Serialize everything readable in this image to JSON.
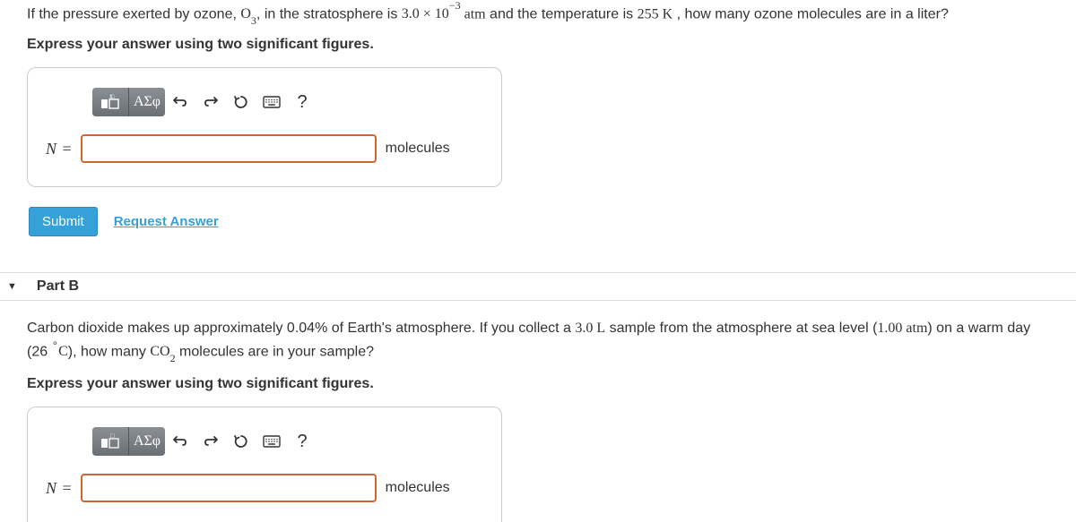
{
  "partA": {
    "q_prefix": "If the pressure exerted by ozone, ",
    "q_ozone": "O",
    "q_ozone_sub": "3",
    "q_mid1": ", in the stratosphere is ",
    "q_val1": "3.0 × 10",
    "q_val1_sup": "−3",
    "q_unit1": " atm",
    "q_mid2": " and the temperature is ",
    "q_val2": "255 ",
    "q_unit2": "K",
    "q_end": " , how many ozone molecules are in a liter?",
    "instruct": "Express your answer using two significant figures.",
    "toolbar": {
      "math_label": "ΑΣφ",
      "help": "?"
    },
    "var": "N",
    "eq": "=",
    "unit": "molecules",
    "submit": "Submit",
    "request": "Request Answer"
  },
  "partB": {
    "header": "Part B",
    "q_pre": "Carbon dioxide makes up approximately 0.04% of Earth's atmosphere. If you collect a ",
    "q_vol": "3.0 ",
    "q_vol_unit": "L",
    "q_mid": " sample from the atmosphere at sea level (",
    "q_pres": "1.00 ",
    "q_pres_unit": "atm",
    "q_mid2": ") on a warm day (26 ",
    "q_deg_unit": "C",
    "q_mid3": "), how many ",
    "q_co2": "CO",
    "q_co2_sub": "2",
    "q_end": " molecules are in your sample?",
    "instruct": "Express your answer using two significant figures.",
    "toolbar": {
      "math_label": "ΑΣφ",
      "help": "?"
    },
    "var": "N",
    "eq": "=",
    "unit": "molecules"
  }
}
